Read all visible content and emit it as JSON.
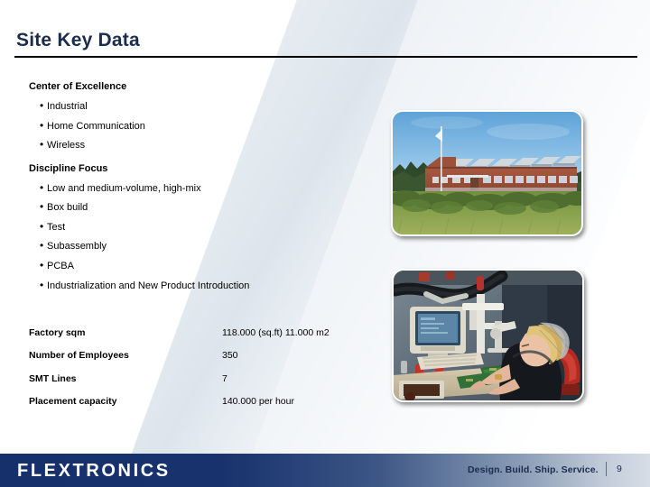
{
  "slide": {
    "title": "Site Key Data",
    "page_number": "9"
  },
  "sections": [
    {
      "heading": "Center of Excellence",
      "bullets": [
        "Industrial",
        "Home Communication",
        "Wireless"
      ]
    },
    {
      "heading": "Discipline Focus",
      "bullets": [
        "Low and medium-volume, high-mix",
        "Box build",
        "Test",
        "Subassembly",
        "PCBA",
        "Industrialization and New Product Introduction"
      ]
    }
  ],
  "key_data": {
    "rows": [
      {
        "label": "Factory sqm",
        "value": "118.000 (sq.ft) 11.000 m2"
      },
      {
        "label": "Number of Employees",
        "value": "350"
      },
      {
        "label": "SMT Lines",
        "value": "7"
      },
      {
        "label": "Placement capacity",
        "value": "140.000 per hour"
      }
    ]
  },
  "photos": [
    {
      "name": "factory-building-exterior",
      "alt": "Brick factory building with sawtooth roof, flagpole and green field"
    },
    {
      "name": "assembly-workstation-operator",
      "alt": "Operator at electronics assembly workstation with monitor, microscope and PCB"
    }
  ],
  "footer": {
    "logo_text": "FLEXTRONICS",
    "tagline": "Design. Build. Ship. Service.",
    "page_number": "9"
  },
  "colors": {
    "title_navy": "#1b2c4f",
    "footer_navy": "#16306b",
    "band_blue": "#e6ecf1"
  }
}
